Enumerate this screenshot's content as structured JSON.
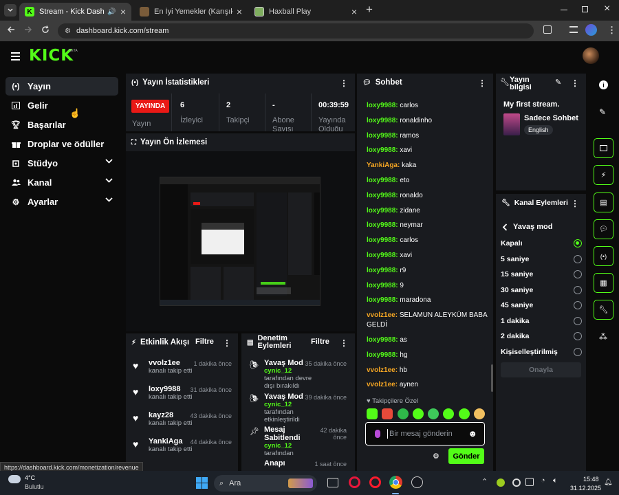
{
  "browser": {
    "tabs": [
      {
        "label": "Stream - Kick Dashboard",
        "active": true
      },
      {
        "label": "En İyi Yemekler (Karışık) - Tier L",
        "active": false
      },
      {
        "label": "Haxball Play",
        "active": false
      }
    ],
    "url": "dashboard.kick.com/stream",
    "status_url": "https://dashboard.kick.com/monetization/revenue"
  },
  "app": {
    "logo": "KICK",
    "logo_badge": "BETA",
    "accent": "#53fc18"
  },
  "sidebar": {
    "items": [
      {
        "label": "Yayın",
        "icon": "broadcast-icon",
        "active": true
      },
      {
        "label": "Gelir",
        "icon": "revenue-icon"
      },
      {
        "label": "Başarılar",
        "icon": "trophy-icon"
      },
      {
        "label": "Droplar ve ödüller",
        "icon": "gift-icon"
      },
      {
        "label": "Stüdyo",
        "icon": "studio-icon",
        "expandable": true
      },
      {
        "label": "Kanal",
        "icon": "users-icon",
        "expandable": true
      },
      {
        "label": "Ayarlar",
        "icon": "gear-icon",
        "expandable": true
      }
    ]
  },
  "stats": {
    "title": "Yayın İstatistikleri",
    "live_badge": "YAYINDA",
    "columns": [
      {
        "value": "",
        "label": "Yayın"
      },
      {
        "value": "6",
        "label": "İzleyici"
      },
      {
        "value": "2",
        "label": "Takipçi"
      },
      {
        "value": "-",
        "label": "Abone Sayısı"
      },
      {
        "value": "00:39:59",
        "label": "Yayında Olduğu"
      }
    ]
  },
  "preview": {
    "title": "Yayın Ön İzlemesi"
  },
  "activity": {
    "title": "Etkinlik Akışı",
    "filter": "Filtre",
    "items": [
      {
        "name": "vvolz1ee",
        "sub": "kanalı takip etti",
        "time": "1 dakika önce"
      },
      {
        "name": "loxy9988",
        "sub": "kanalı takip etti",
        "time": "31 dakika önce"
      },
      {
        "name": "kayz28",
        "sub": "kanalı takip etti",
        "time": "43 dakika önce"
      },
      {
        "name": "YankiAga",
        "sub": "kanalı takip etti",
        "time": "44 dakika önce"
      }
    ]
  },
  "moderation": {
    "title": "Denetim Eylemleri",
    "filter": "Filtre",
    "items": [
      {
        "name": "Yavaş Mod",
        "user": "cynic_12",
        "sub": "tarafından devre dışı bırakıldı",
        "time": "35 dakika önce"
      },
      {
        "name": "Yavaş Mod",
        "user": "cynic_12",
        "sub": "tarafından etkinleştirildi",
        "time": "39 dakika önce"
      },
      {
        "name": "Mesaj Sabitlendi",
        "user": "cynic_12",
        "sub": "tarafından",
        "time": "42 dakika önce"
      },
      {
        "name": "Anapı",
        "user": "",
        "sub": "",
        "time": "1 saat önce"
      }
    ]
  },
  "chat": {
    "title": "Sohbet",
    "messages": [
      {
        "user": "loxy9988",
        "text": "carlos",
        "color": "#53fc18"
      },
      {
        "user": "loxy9988",
        "text": "ronaldinho",
        "color": "#53fc18"
      },
      {
        "user": "loxy9988",
        "text": "ramos",
        "color": "#53fc18"
      },
      {
        "user": "loxy9988",
        "text": "xavi",
        "color": "#53fc18"
      },
      {
        "user": "YankiAga",
        "text": "kaka",
        "color": "#f5a623"
      },
      {
        "user": "loxy9988",
        "text": "eto",
        "color": "#53fc18"
      },
      {
        "user": "loxy9988",
        "text": "ronaldo",
        "color": "#53fc18"
      },
      {
        "user": "loxy9988",
        "text": "zidane",
        "color": "#53fc18"
      },
      {
        "user": "loxy9988",
        "text": "neymar",
        "color": "#53fc18"
      },
      {
        "user": "loxy9988",
        "text": "carlos",
        "color": "#53fc18"
      },
      {
        "user": "loxy9988",
        "text": "xavi",
        "color": "#53fc18"
      },
      {
        "user": "loxy9988",
        "text": "r9",
        "color": "#53fc18"
      },
      {
        "user": "loxy9988",
        "text": "9",
        "color": "#53fc18"
      },
      {
        "user": "loxy9988",
        "text": "maradona",
        "color": "#53fc18"
      },
      {
        "user": "vvolz1ee",
        "text": "SELAMUN ALEYKÜM BABA",
        "text2": "GELDİ",
        "color": "#f5a623"
      },
      {
        "user": "loxy9988",
        "text": "as",
        "color": "#53fc18"
      },
      {
        "user": "loxy9988",
        "text": "hg",
        "color": "#53fc18"
      },
      {
        "user": "vvolz1ee",
        "text": "hb",
        "color": "#f5a623"
      },
      {
        "user": "vvolz1ee",
        "text": "aynen",
        "color": "#f5a623"
      }
    ],
    "followers_only": "Takipçilere Özel",
    "placeholder": "Bir mesaj gönderin",
    "send_label": "Gönder"
  },
  "stream_info": {
    "title": "Yayın bilgisi",
    "stream_title": "My first stream.",
    "category": "Sadece Sohbet",
    "language": "English"
  },
  "channel_actions": {
    "title": "Kanal Eylemleri",
    "back_label": "Yavaş mod",
    "options": [
      "Kapalı",
      "5 saniye",
      "15 saniye",
      "30 saniye",
      "45 saniye",
      "1 dakika",
      "2 dakika",
      "Kişiselleştirilmiş"
    ],
    "selected": 0,
    "confirm_label": "Onayla"
  },
  "taskbar": {
    "weather_temp": "4°C",
    "weather_desc": "Bulutlu",
    "search": "Ara",
    "time": "15:48",
    "date": "31.12.2025"
  }
}
